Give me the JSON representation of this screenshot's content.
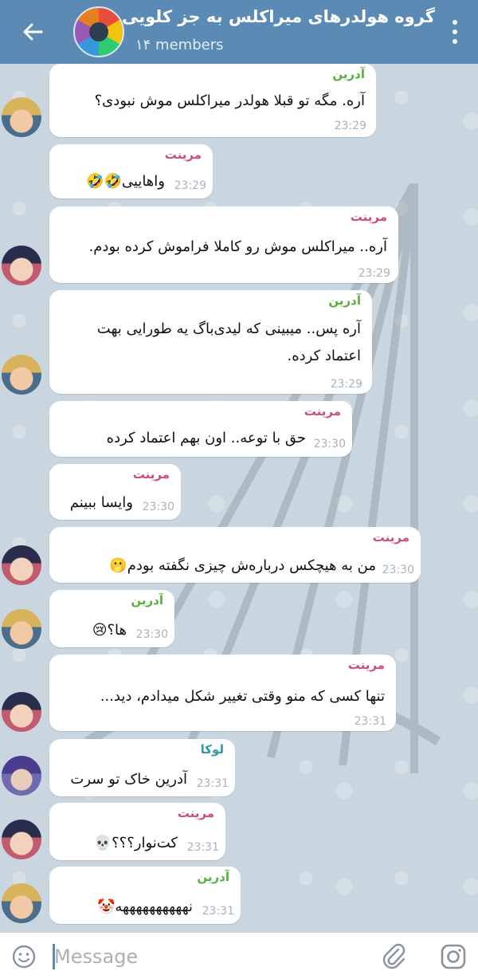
{
  "header": {
    "title": "گروه هولدرهای میراکلس به جز کلویی",
    "members": "۱۴ members",
    "bg_color": "#5b8bb4"
  },
  "messages": [
    {
      "sender": "آدرین",
      "text": "آره. مگه تو قبلا هولدر میراکلس موش نبودی؟",
      "time": "23:29"
    },
    {
      "sender": "مرینت",
      "text": "واهاییی🤣🤣",
      "time": "23:29"
    },
    {
      "sender": "مرینت",
      "text": "آره.. میراکلس موش رو کاملا فراموش کرده بودم.",
      "time": "23:29"
    },
    {
      "sender": "آدرین",
      "line1": "آره پس.. میبینی که لیدی‌باگ یه طورایی بهت",
      "line2": "اعتماد کرده.",
      "time": "23:29"
    },
    {
      "sender": "مرینت",
      "text": "حق با توعه.. اون بهم اعتماد کرده",
      "time": "23:30"
    },
    {
      "sender": "مرینت",
      "text": "وایسا ببینم",
      "time": "23:30"
    },
    {
      "sender": "مرینت",
      "text": "من به هیچکس دربارەش چیزی نگفته بودم🫢",
      "time": "23:30"
    },
    {
      "sender": "آدرین",
      "text": "ها؟😢",
      "time": "23:30"
    },
    {
      "sender": "مرینت",
      "text": "تنها کسی که منو وقتی تغییر شکل میدادم، دید...",
      "time": "23:31"
    },
    {
      "sender": "لوکا",
      "text": "آدرین خاک تو سرت",
      "time": "23:31"
    },
    {
      "sender": "مرینت",
      "text": "کت‌نوار؟؟؟💀",
      "time": "23:31"
    },
    {
      "sender": "آدرین",
      "text": "نههههههههههه🤡",
      "time": "23:31"
    }
  ],
  "input": {
    "placeholder": "Message"
  },
  "icons": {
    "back": "back-arrow-icon",
    "menu": "vertical-dots-icon",
    "emoji": "emoji-icon",
    "attach": "paperclip-icon",
    "camera": "instagram-camera-icon"
  }
}
